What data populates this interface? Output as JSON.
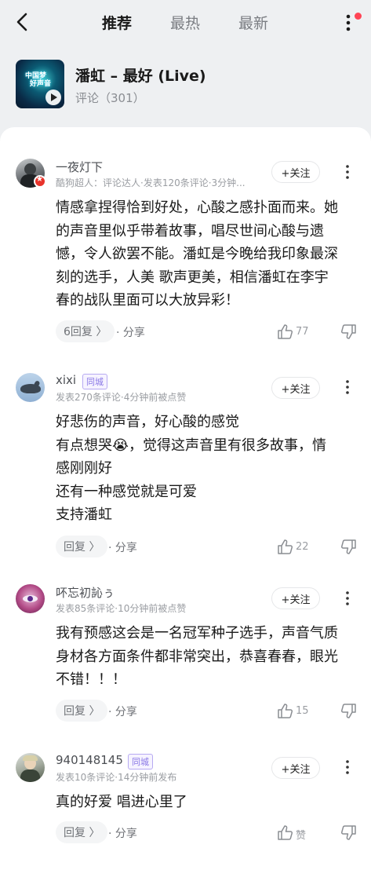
{
  "nav": {
    "tabs": [
      "推荐",
      "最热",
      "最新"
    ],
    "active_tab": 0
  },
  "song": {
    "title": "潘虹 – 最好 (Live)",
    "comment_count": "评论（301）",
    "cover_text": [
      "中国梦",
      "好声音"
    ]
  },
  "comments": [
    {
      "username": "一夜灯下",
      "meta": "酷狗超人：评论达人·发表120条评论·3分钟...",
      "follow_label": "+关注",
      "lines": [
        "情感拿捏得恰到好处，心酸之感扑面而来。她",
        "的声音里似乎带着故事，唱尽世间心酸与遗",
        "憾，令人欲罢不能。潘虹是今晚给我印象最深",
        "刻的选手，人美 歌声更美，相信潘虹在李宇",
        "春的战队里面可以大放异彩！"
      ],
      "reply_label": "6回复 〉",
      "share_label": "· 分享",
      "likes": "77"
    },
    {
      "username": "xixi",
      "city_tag": "同城",
      "meta": "发表270条评论·4分钟前被点赞",
      "follow_label": "+关注",
      "lines": [
        "好悲伤的声音，好心酸的感觉",
        "有点想哭😭，觉得这声音里有很多故事，情",
        "感刚刚好",
        "还有一种感觉就是可爱",
        "支持潘虹"
      ],
      "reply_label": "回复 〉",
      "share_label": "· 分享",
      "likes": "22"
    },
    {
      "username": "吥忘初訫ぅ",
      "meta": "发表85条评论·10分钟前被点赞",
      "follow_label": "+关注",
      "lines": [
        "我有预感这会是一名冠军种子选手，声音气质",
        "身材各方面条件都非常突出，恭喜春春，眼光",
        "不错！！！"
      ],
      "reply_label": "回复 〉",
      "share_label": "· 分享",
      "likes": "15"
    },
    {
      "username": "940148145",
      "city_tag": "同城",
      "meta": "发表10条评论·14分钟前发布",
      "follow_label": "+关注",
      "lines": [
        "真的好爱 唱进心里了"
      ],
      "reply_label": "回复 〉",
      "share_label": "· 分享",
      "likes": "赞"
    }
  ],
  "colors": {
    "accent_red": "#ff4455",
    "city_tag": "#8a78e6"
  }
}
